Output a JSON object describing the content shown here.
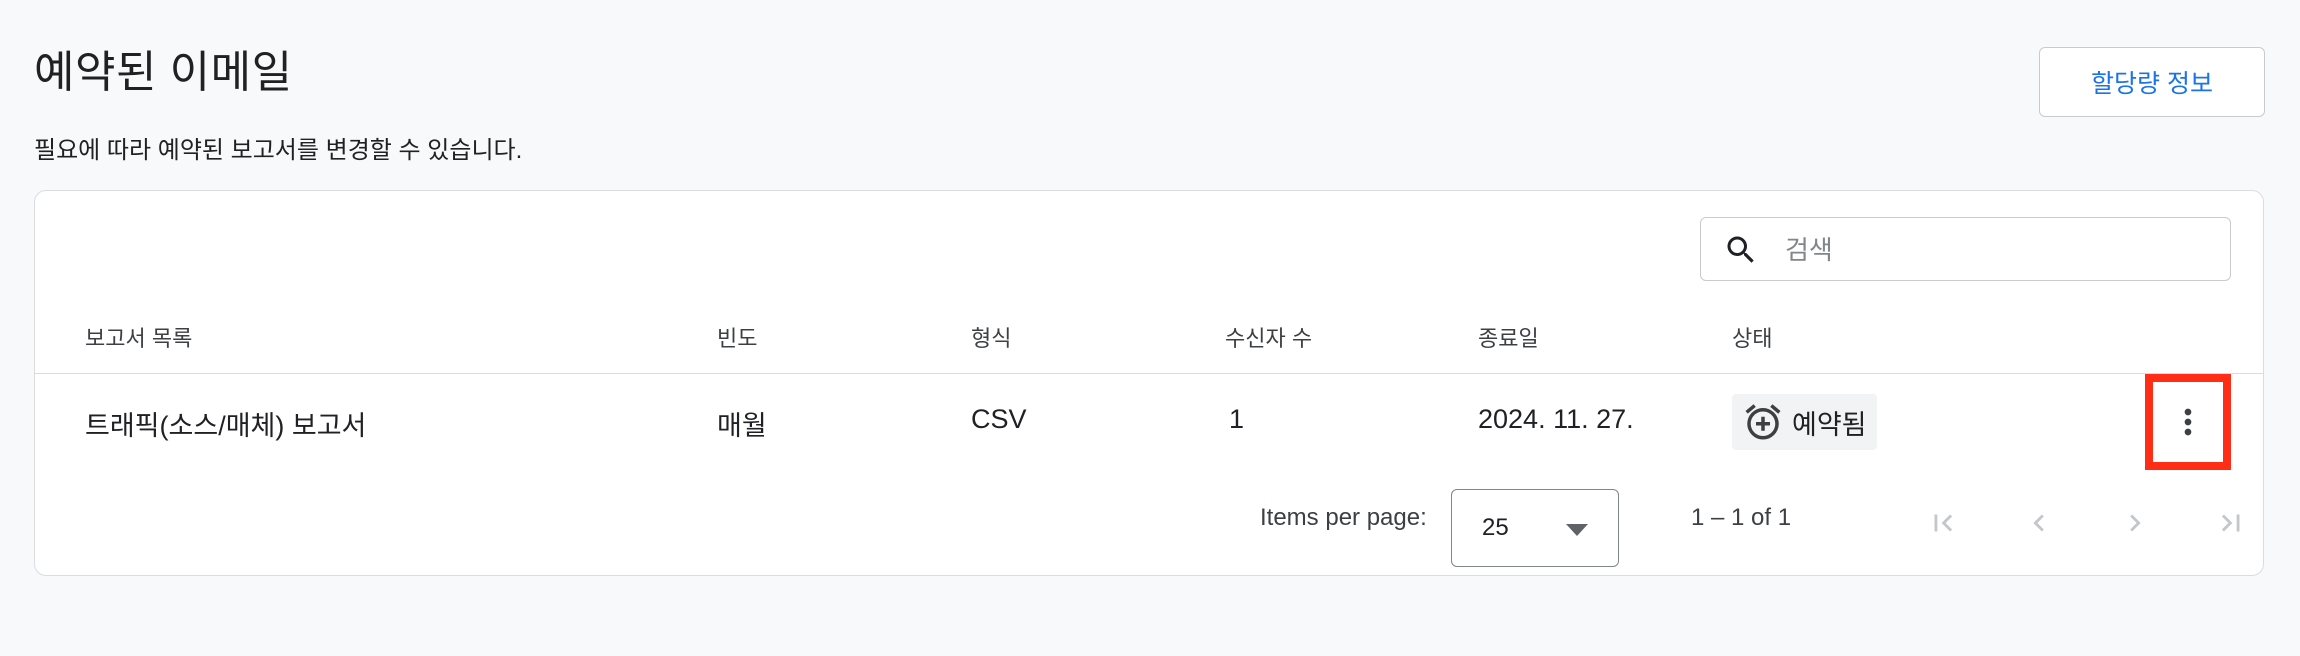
{
  "header": {
    "title": "예약된 이메일",
    "subtitle": "필요에 따라 예약된 보고서를 변경할 수 있습니다.",
    "quota_button": "할당량 정보"
  },
  "search": {
    "placeholder": "검색",
    "value": "",
    "icon": "search-icon"
  },
  "table": {
    "columns": [
      "보고서 목록",
      "빈도",
      "형식",
      "수신자 수",
      "종료일",
      "상태"
    ],
    "rows": [
      {
        "report": "트래픽(소스/매체) 보고서",
        "frequency": "매월",
        "format": "CSV",
        "recipients": "1",
        "end_date": "2024. 11. 27.",
        "status": "예약됨",
        "status_icon": "alarm-add-icon",
        "menu_icon": "more-vert-icon"
      }
    ]
  },
  "pagination": {
    "items_per_page_label": "Items per page:",
    "items_per_page_value": "25",
    "range_text": "1 – 1 of 1",
    "buttons": [
      "first-page-icon",
      "prev-page-icon",
      "next-page-icon",
      "last-page-icon"
    ]
  },
  "colors": {
    "accent": "#1a73e8",
    "highlight_box": "#ff2d16",
    "page_bg": "#f8f9fa",
    "chip_bg": "#f1f3f4"
  }
}
